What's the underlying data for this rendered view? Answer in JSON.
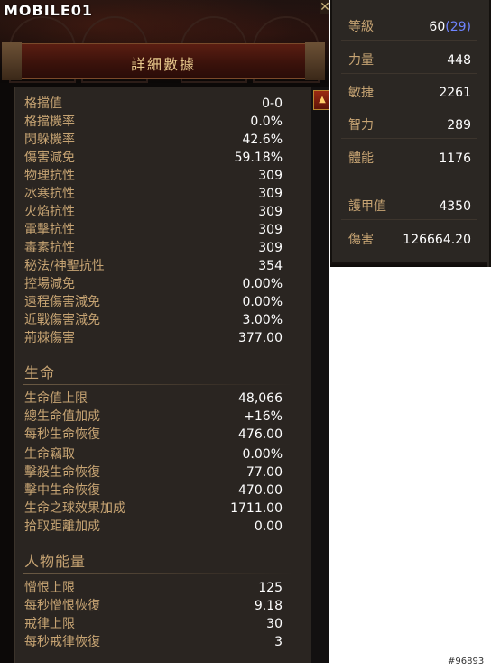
{
  "watermark": "MOBILE01",
  "close_icon": "close-icon",
  "panel": {
    "title": "詳細數據",
    "scroll_up_icon": "triangle-up-icon"
  },
  "defense_stats": [
    {
      "label": "格擋值",
      "value": "0-0"
    },
    {
      "label": "格擋機率",
      "value": "0.0%"
    },
    {
      "label": "閃躲機率",
      "value": "42.6%"
    },
    {
      "label": "傷害減免",
      "value": "59.18%"
    },
    {
      "label": "物理抗性",
      "value": "309"
    },
    {
      "label": "冰寒抗性",
      "value": "309"
    },
    {
      "label": "火焰抗性",
      "value": "309"
    },
    {
      "label": "電擊抗性",
      "value": "309"
    },
    {
      "label": "毒素抗性",
      "value": "309"
    },
    {
      "label": "秘法/神聖抗性",
      "value": "354"
    },
    {
      "label": "控場減免",
      "value": "0.00%"
    },
    {
      "label": "遠程傷害減免",
      "value": "0.00%"
    },
    {
      "label": "近戰傷害減免",
      "value": "3.00%"
    },
    {
      "label": "荊棘傷害",
      "value": "377.00"
    }
  ],
  "life_section": {
    "heading": "生命",
    "stats": [
      {
        "label": "生命值上限",
        "value": "48,066"
      },
      {
        "label": "總生命值加成",
        "value": "+16%"
      },
      {
        "label": "每秒生命恢復",
        "value": "476.00"
      },
      {
        "label": "生命竊取",
        "value": "0.00%"
      },
      {
        "label": "擊殺生命恢復",
        "value": "77.00"
      },
      {
        "label": "擊中生命恢復",
        "value": "470.00"
      },
      {
        "label": "生命之球效果加成",
        "value": "1711.00"
      },
      {
        "label": "拾取距離加成",
        "value": "0.00"
      }
    ]
  },
  "resource_section": {
    "heading": "人物能量",
    "stats": [
      {
        "label": "憎恨上限",
        "value": "125"
      },
      {
        "label": "每秒憎恨恢復",
        "value": "9.18"
      },
      {
        "label": "戒律上限",
        "value": "30"
      },
      {
        "label": "每秒戒律恢復",
        "value": "3"
      }
    ]
  },
  "summary": {
    "level_label": "等級",
    "level_value": "60",
    "paragon_value": "(29)",
    "attributes": [
      {
        "label": "力量",
        "value": "448"
      },
      {
        "label": "敏捷",
        "value": "2261"
      },
      {
        "label": "智力",
        "value": "289"
      },
      {
        "label": "體能",
        "value": "1176"
      }
    ],
    "armor_label": "護甲值",
    "armor_value": "4350",
    "damage_label": "傷害",
    "damage_value": "126664.20"
  },
  "image_tag": "#96893",
  "colors": {
    "label": "#c7a473",
    "value": "#ffffff",
    "paragon": "#6f84ff",
    "panel_bg": "#2a2521"
  }
}
